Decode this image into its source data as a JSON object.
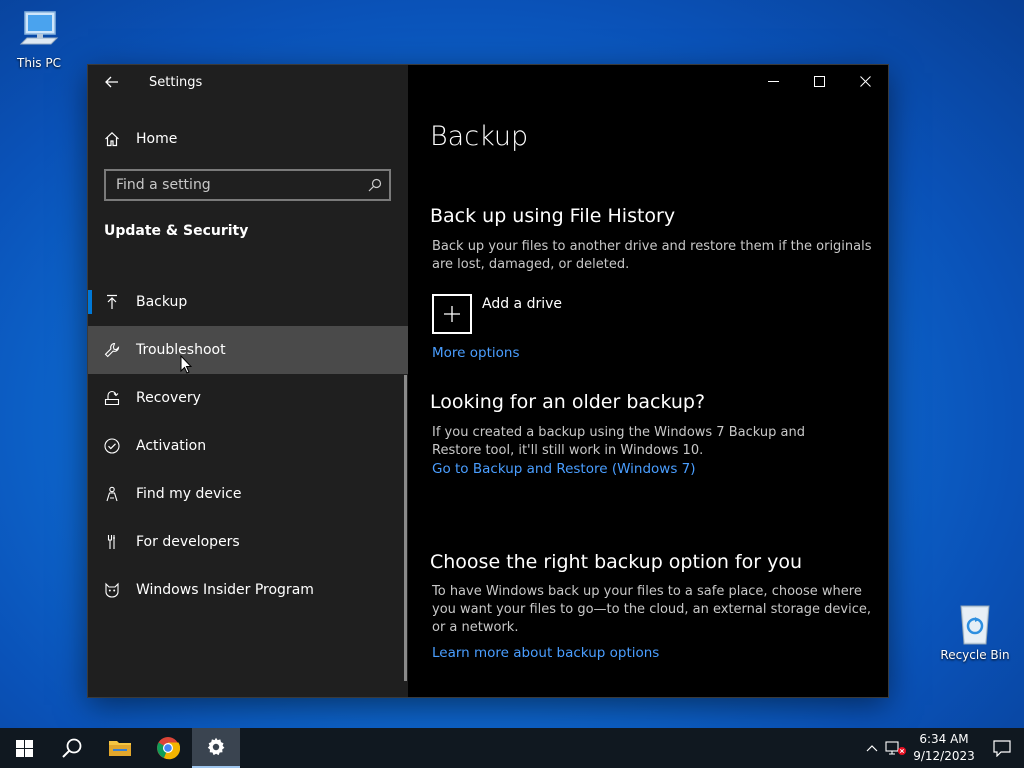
{
  "desktop": {
    "this_pc_label": "This PC",
    "recycle_bin_label": "Recycle Bin"
  },
  "window": {
    "title": "Settings",
    "controls": [
      "minimize-icon",
      "maximize-icon",
      "close-icon"
    ]
  },
  "sidebar": {
    "home_label": "Home",
    "search_placeholder": "Find a setting",
    "section_title": "Update & Security",
    "items": [
      {
        "label": "Backup",
        "icon": "backup-arrow-icon",
        "selected": true
      },
      {
        "label": "Troubleshoot",
        "icon": "wrench-icon",
        "hovered": true
      },
      {
        "label": "Recovery",
        "icon": "recovery-icon"
      },
      {
        "label": "Activation",
        "icon": "check-circle-icon"
      },
      {
        "label": "Find my device",
        "icon": "person-location-icon"
      },
      {
        "label": "For developers",
        "icon": "developer-tools-icon"
      },
      {
        "label": "Windows Insider Program",
        "icon": "insider-cat-icon"
      }
    ]
  },
  "main": {
    "page_title": "Backup",
    "file_history": {
      "heading": "Back up using File History",
      "description": "Back up your files to another drive and restore them if the originals are lost, damaged, or deleted.",
      "add_drive_label": "Add a drive",
      "more_options_link": "More options"
    },
    "older_backup": {
      "heading": "Looking for an older backup?",
      "description": "If you created a backup using the Windows 7 Backup and Restore tool, it'll still work in Windows 10.",
      "link": "Go to Backup and Restore (Windows 7)"
    },
    "right_option": {
      "heading": "Choose the right backup option for you",
      "description": "To have Windows back up your files to a safe place, choose where you want your files to go—to the cloud, an external storage device, or a network.",
      "link": "Learn more about backup options"
    }
  },
  "taskbar": {
    "time": "6:34 AM",
    "date": "9/12/2023"
  },
  "colors": {
    "accent": "#0078d7",
    "link": "#4a9eff",
    "sidebar_bg": "#1f1f1f",
    "hover_bg": "#4a4a4a"
  }
}
